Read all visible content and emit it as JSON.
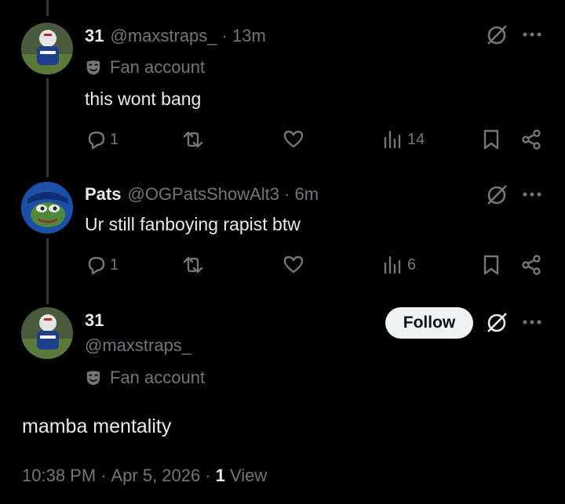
{
  "tweets": [
    {
      "display_name": "31",
      "handle": "@maxstraps_",
      "time": "· 13m",
      "label": "Fan account",
      "text": "this wont bang",
      "replies": "1",
      "views": "14"
    },
    {
      "display_name": "Pats",
      "handle": "@OGPatsShowAlt3",
      "time": "· 6m",
      "text": "Ur still fanboying rapist btw",
      "replies": "1",
      "views": "6"
    }
  ],
  "main": {
    "display_name": "31",
    "handle": "@maxstraps_",
    "label": "Fan account",
    "follow_label": "Follow",
    "text": "mamba mentality",
    "time": "10:38 PM",
    "sep1": "·",
    "date": "Apr 5, 2026",
    "sep2": "·",
    "view_count": "1",
    "view_label": "View"
  },
  "colors": {
    "background": "#000000",
    "text": "#e7e9ea",
    "muted": "#71767b",
    "follow_bg": "#eff3f4"
  },
  "icons": [
    "reply-icon",
    "retweet-icon",
    "like-icon",
    "views-icon",
    "bookmark-icon",
    "share-icon",
    "grok-icon",
    "more-icon",
    "fan-account-mask-icon"
  ]
}
